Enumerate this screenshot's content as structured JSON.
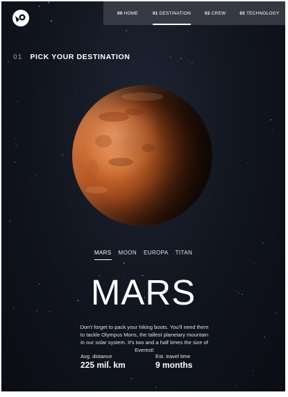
{
  "nav": {
    "items": [
      {
        "num": "00",
        "label": "HOME",
        "active": false
      },
      {
        "num": "01",
        "label": "DESTINATION",
        "active": true
      },
      {
        "num": "02",
        "label": "CREW",
        "active": false
      },
      {
        "num": "03",
        "label": "TECHNOLOGY",
        "active": false
      }
    ]
  },
  "heading": {
    "num": "01",
    "text": "PICK YOUR DESTINATION"
  },
  "tabs": [
    {
      "label": "MARS",
      "active": true
    },
    {
      "label": "MOON",
      "active": false
    },
    {
      "label": "EUROPA",
      "active": false
    },
    {
      "label": "TITAN",
      "active": false
    }
  ],
  "planet": {
    "name": "MARS",
    "description": "Don't forget to pack your hiking boots. You'll need them to tackle Olympus Mons, the tallest planetary mountain in our solar system. It's two and a half times the size of Everest!"
  },
  "stats": {
    "distance": {
      "label": "Avg. distance",
      "value": "225 mil. km"
    },
    "travel": {
      "label": "Est. travel time",
      "value": "9 months"
    }
  },
  "colors": {
    "background": "#0b0d14",
    "navbar": "#3c404a",
    "planet": "#c25f28"
  }
}
